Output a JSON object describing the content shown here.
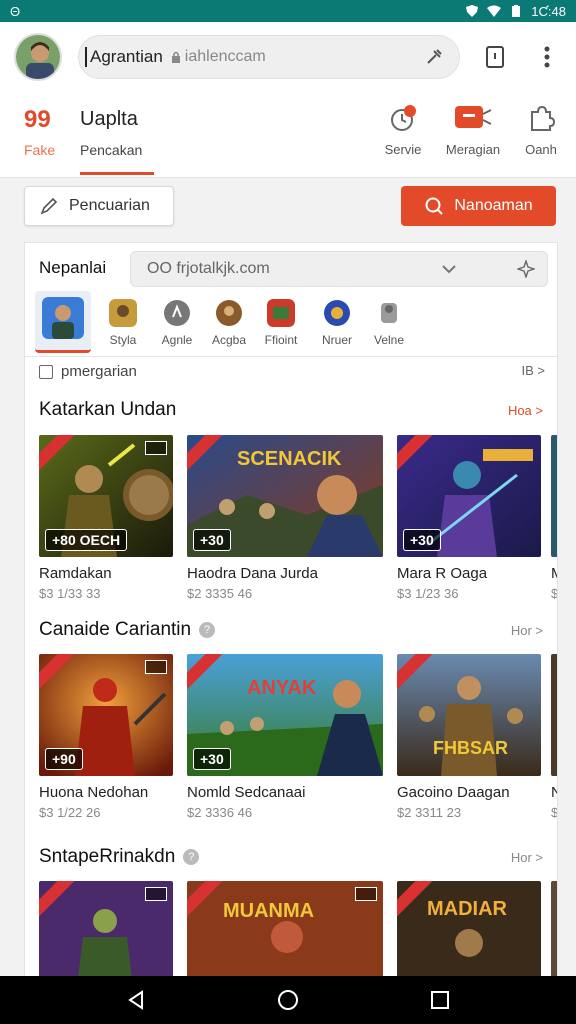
{
  "status": {
    "left_icon": "circle-theta",
    "time": "1Ƈ:48",
    "icons": [
      "shield-icon",
      "wifi-icon",
      "battery-icon"
    ]
  },
  "topbar": {
    "url_title": "Agrantian",
    "url_text": "iahlenccam"
  },
  "tabs": {
    "number": "99",
    "fake_label": "Fake",
    "title": "Uaplta",
    "subtitle": "Pencakan",
    "icons": [
      {
        "label": "Servie",
        "icon": "alert-clock-icon"
      },
      {
        "label": "Meragian",
        "icon": "red-message-icon"
      },
      {
        "label": "Oanh",
        "icon": "puzzle-icon"
      }
    ]
  },
  "actions": {
    "search_label": "Pencuarian",
    "primary_label": "Nanoaman"
  },
  "panel": {
    "title": "Nepanlai",
    "url": "OO frjotalkjk.com",
    "categories": [
      {
        "label": "",
        "color": "#3a7bd5"
      },
      {
        "label": "Styla",
        "color": "#c79b3a"
      },
      {
        "label": "Agnle",
        "color": "#777777"
      },
      {
        "label": "Acgba",
        "color": "#8a5a2a"
      },
      {
        "label": "Ffioint",
        "color": "#cc3a2a"
      },
      {
        "label": "Nruer",
        "color": "#2a4cb0"
      },
      {
        "label": "Velne",
        "color": "#9a9a9a"
      }
    ],
    "crumb": "pmergarian",
    "crumb_right": "IB >"
  },
  "sections": [
    {
      "title": "Katarkan Undan",
      "more": "Hoa >",
      "more_color": "#e24a2a",
      "cards": [
        {
          "badge": "+80",
          "overlay": "OECH",
          "title": "Ramdakan",
          "meta": "$3 1/33 33"
        },
        {
          "badge": "+30",
          "overlay": "SCENACIK",
          "title": "Haodra Dana Jurda",
          "meta": "$2 3335 46"
        },
        {
          "badge": "+30",
          "overlay": "",
          "title": "Mara R Oaga",
          "meta": "$3 1/23 36"
        },
        {
          "badge": "",
          "overlay": "",
          "title": "M",
          "meta": "$"
        }
      ]
    },
    {
      "title": "Canaide Cariantin",
      "more": "Hor >",
      "more_color": "#888888",
      "cards": [
        {
          "badge": "+90",
          "overlay": "",
          "title": "Huona Nedohan",
          "meta": "$3 1/22 26"
        },
        {
          "badge": "+30",
          "overlay": "ANYAK",
          "title": "Nomld Sedcanaai",
          "meta": "$2 3336 46"
        },
        {
          "badge": "",
          "overlay": "FHBSAR",
          "title": "Gacoino Daagan",
          "meta": "$2 3311 23"
        },
        {
          "badge": "",
          "overlay": "",
          "title": "N",
          "meta": "$"
        }
      ]
    },
    {
      "title": "SntapeRrinakdn",
      "more": "Hor >",
      "more_color": "#888888",
      "cards": [
        {
          "badge": "",
          "overlay": "",
          "title": "",
          "meta": ""
        },
        {
          "badge": "",
          "overlay": "MUANMA",
          "title": "",
          "meta": ""
        },
        {
          "badge": "",
          "overlay": "MADIAR",
          "title": "",
          "meta": ""
        },
        {
          "badge": "",
          "overlay": "",
          "title": "",
          "meta": ""
        }
      ]
    }
  ]
}
